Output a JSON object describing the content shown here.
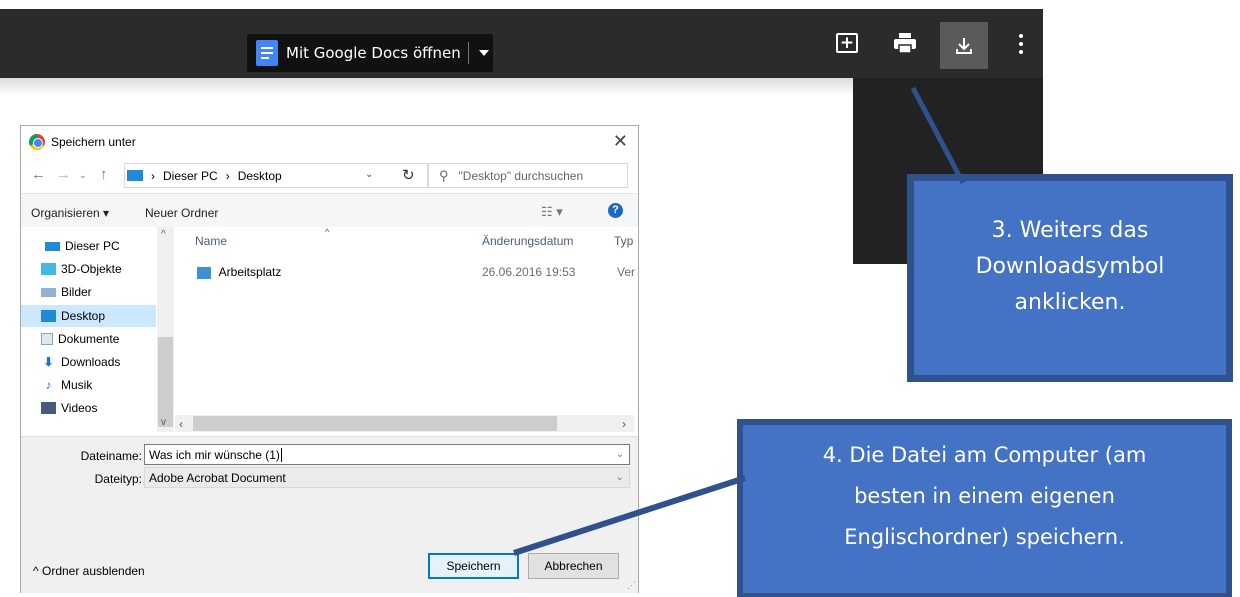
{
  "viewer": {
    "open_with_label": "Mit Google Docs öffnen",
    "icons": [
      "docs-icon",
      "add-comment-icon",
      "print-icon",
      "download-icon",
      "more-vert-icon"
    ]
  },
  "dialog": {
    "title": "Speichern unter",
    "breadcrumb": [
      "Dieser PC",
      "Desktop"
    ],
    "search_placeholder": "\"Desktop\" durchsuchen",
    "toolbar": {
      "organize": "Organisieren",
      "new_folder": "Neuer Ordner"
    },
    "nav_items": [
      {
        "label": "Dieser PC"
      },
      {
        "label": "3D-Objekte"
      },
      {
        "label": "Bilder"
      },
      {
        "label": "Desktop",
        "selected": true
      },
      {
        "label": "Dokumente"
      },
      {
        "label": "Downloads"
      },
      {
        "label": "Musik"
      },
      {
        "label": "Videos"
      }
    ],
    "columns": {
      "name": "Name",
      "date": "Änderungsdatum",
      "type": "Typ"
    },
    "files": [
      {
        "name": "Arbeitsplatz",
        "date": "26.06.2016 19:53",
        "type": "Ver"
      }
    ],
    "filename_label": "Dateiname:",
    "filename_value": "Was ich mir wünsche (1)",
    "filetype_label": "Dateityp:",
    "filetype_value": "Adobe Acrobat Document",
    "hide_folders": "Ordner ausblenden",
    "save_button": "Speichern",
    "cancel_button": "Abbrechen"
  },
  "callouts": {
    "step3": [
      "3. Weiters das",
      "Downloadsymbol",
      "anklicken."
    ],
    "step4": [
      "4. Die Datei am Computer (am",
      "besten in einem eigenen",
      "Englischordner) speichern."
    ]
  },
  "colors": {
    "callout_fill": "#4472c4",
    "callout_border": "#2f528f",
    "viewer_bar": "#2b2b2b",
    "selection": "#cce8ff"
  }
}
